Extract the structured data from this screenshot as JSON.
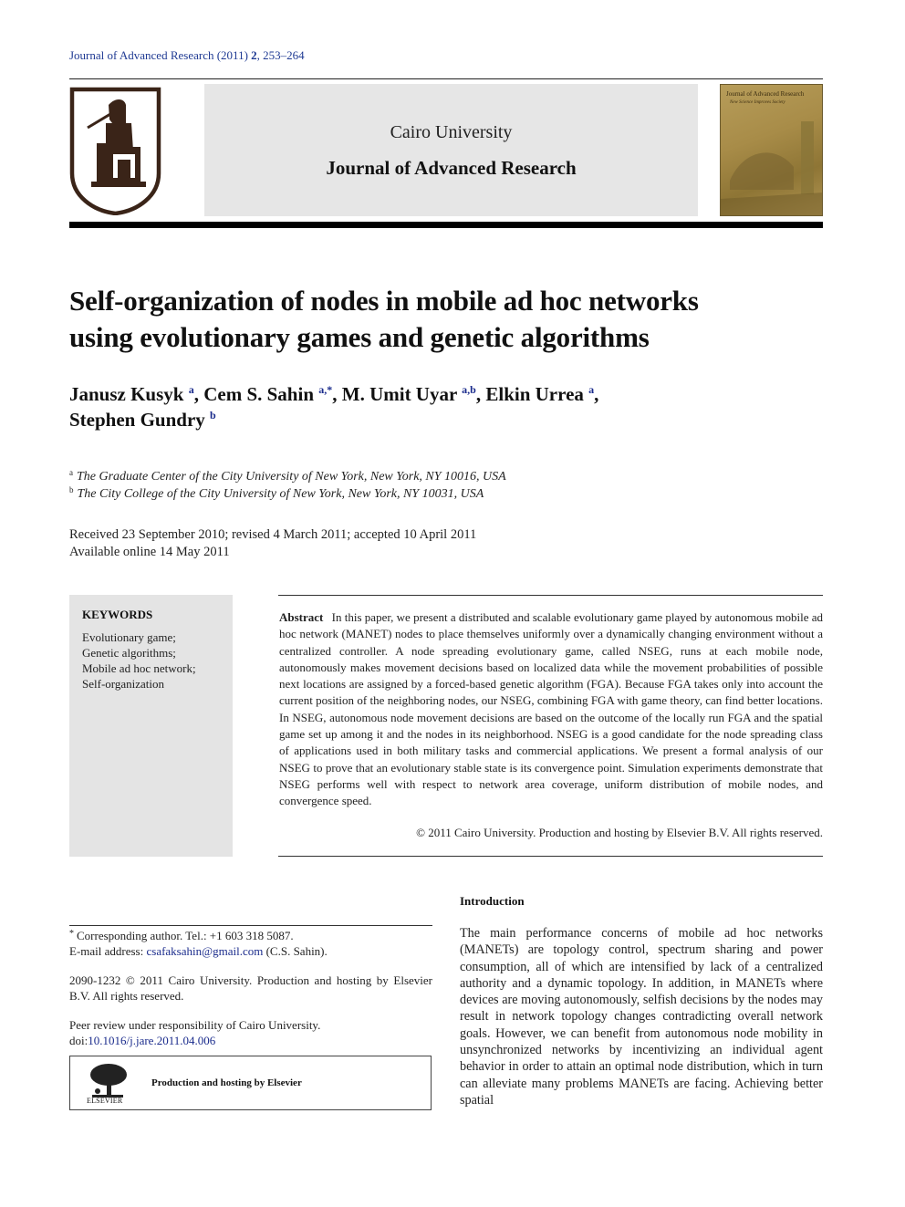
{
  "header": {
    "journal_ref_prefix": "Journal of Advanced Research (2011) ",
    "journal_ref_volume": "2",
    "journal_ref_pages": ", 253–264",
    "university": "Cairo University",
    "journal_name": "Journal of Advanced Research",
    "cover_title": "Journal of Advanced Research",
    "cover_subtitle": "New Science Improves Society"
  },
  "article": {
    "title_line1": "Self-organization of nodes in mobile ad hoc networks",
    "title_line2": "using evolutionary games and genetic algorithms",
    "authors": [
      {
        "name": "Janusz Kusyk",
        "sup": "a",
        "sep": ", "
      },
      {
        "name": "Cem S. Sahin",
        "sup": "a,*",
        "sep": ", "
      },
      {
        "name": "M. Umit Uyar",
        "sup": "a,b",
        "sep": ", "
      },
      {
        "name": "Elkin Urrea",
        "sup": "a",
        "sep": ","
      },
      {
        "name": "Stephen Gundry",
        "sup": "b",
        "sep": ""
      }
    ],
    "affiliations": [
      {
        "mark": "a",
        "text": "The Graduate Center of the City University of New York, New York, NY 10016, USA"
      },
      {
        "mark": "b",
        "text": "The City College of the City University of New York, New York, NY 10031, USA"
      }
    ],
    "dates_line1": "Received 23 September 2010; revised 4 March 2011; accepted 10 April 2011",
    "dates_line2": "Available online 14 May 2011"
  },
  "keywords": {
    "title": "KEYWORDS",
    "items": [
      "Evolutionary game;",
      "Genetic algorithms;",
      "Mobile ad hoc network;",
      "Self-organization"
    ]
  },
  "abstract": {
    "label": "Abstract",
    "text": "In this paper, we present a distributed and scalable evolutionary game played by autonomous mobile ad hoc network (MANET) nodes to place themselves uniformly over a dynamically changing environment without a centralized controller. A node spreading evolutionary game, called NSEG, runs at each mobile node, autonomously makes movement decisions based on localized data while the movement probabilities of possible next locations are assigned by a forced-based genetic algorithm (FGA). Because FGA takes only into account the current position of the neighboring nodes, our NSEG, combining FGA with game theory, can find better locations. In NSEG, autonomous node movement decisions are based on the outcome of the locally run FGA and the spatial game set up among it and the nodes in its neighborhood. NSEG is a good candidate for the node spreading class of applications used in both military tasks and commercial applications. We present a formal analysis of our NSEG to prove that an evolutionary stable state is its convergence point. Simulation experiments demonstrate that NSEG performs well with respect to network area coverage, uniform distribution of mobile nodes, and convergence speed.",
    "copyright": "© 2011 Cairo University. Production and hosting by Elsevier B.V. All rights reserved."
  },
  "footnotes": {
    "star": "*",
    "corresponding": "Corresponding author. Tel.: +1 603 318 5087.",
    "email_label": "E-mail address: ",
    "email": "csafaksahin@gmail.com",
    "email_suffix": " (C.S. Sahin).",
    "issn_line": "2090-1232 © 2011 Cairo University. Production and hosting by Elsevier B.V. All rights reserved.",
    "peer_review": "Peer review under responsibility of Cairo University.",
    "doi_label": "doi:",
    "doi": "10.1016/j.jare.2011.04.006",
    "elsevier_word": "ELSEVIER",
    "elsevier_text": "Production and hosting by Elsevier"
  },
  "introduction": {
    "heading": "Introduction",
    "text": "The main performance concerns of mobile ad hoc networks (MANETs) are topology control, spectrum sharing and power consumption, all of which are intensified by lack of a centralized authority and a dynamic topology. In addition, in MANETs where devices are moving autonomously, selfish decisions by the nodes may result in network topology changes contradicting overall network goals. However, we can benefit from autonomous node mobility in unsynchronized networks by incentivizing an individual agent behavior in order to attain an optimal node distribution, which in turn can alleviate many problems MANETs are facing. Achieving better spatial"
  },
  "colors": {
    "link": "#1a2b8c",
    "header_box": "#e6e6e6",
    "keywords_box": "#e4e4e4"
  }
}
